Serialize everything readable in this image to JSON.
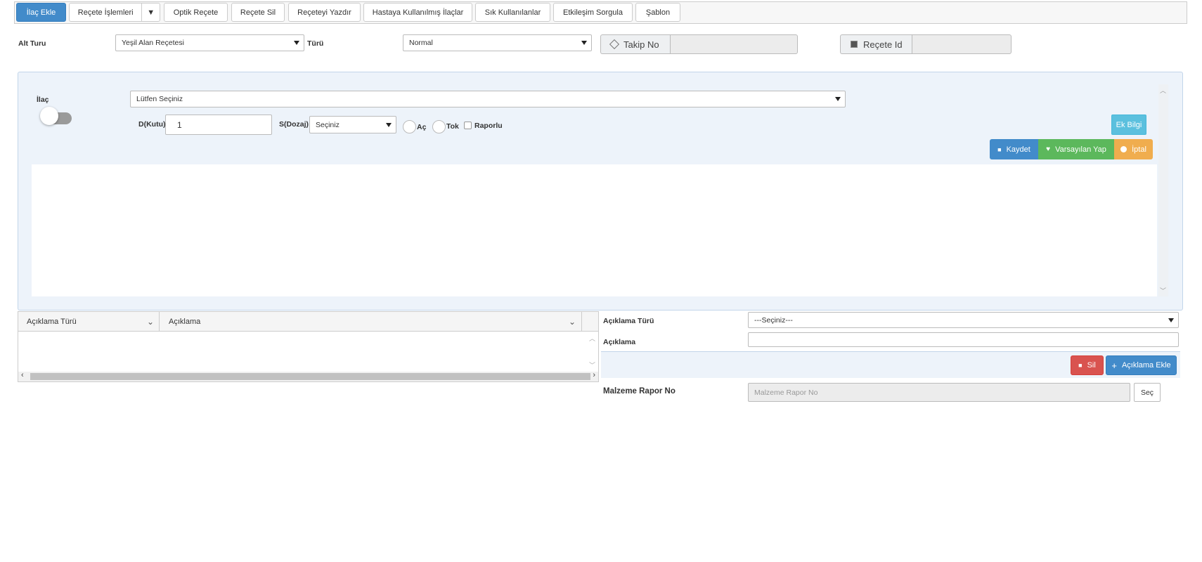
{
  "toolbar": {
    "ilac_ekle": "İlaç Ekle",
    "recete_islemleri": "Reçete İşlemleri",
    "optik_recete": "Optik Reçete",
    "recete_sil": "Reçete Sil",
    "receteyi_yazdir": "Reçeteyi Yazdır",
    "hastaya_kullanilmis": "Hastaya Kullanılmış İlaçlar",
    "sik_kullanilanlar": "Sık Kullanılanlar",
    "etkilesim_sorgula": "Etkileşim Sorgula",
    "sablon": "Şablon"
  },
  "header": {
    "alt_turu_label": "Alt Turu",
    "alt_turu_value": "Yeşil Alan Reçetesi",
    "turu_label": "Türü",
    "turu_value": "Normal",
    "takip_no_label": "Takip No",
    "takip_no_value": "",
    "recete_id_label": "Reçete Id",
    "recete_id_value": ""
  },
  "ilac_panel": {
    "ilac_label": "İlaç",
    "ilac_select": "Lütfen Seçiniz",
    "d_kutu_label": "D(Kutu)",
    "d_kutu_value": "1",
    "s_dozaj_label": "S(Dozaj)",
    "s_dozaj_value": "Seçiniz",
    "ac_label": "Aç",
    "tok_label": "Tok",
    "raporlu_label": "Raporlu",
    "ek_bilgi": "Ek Bilgi",
    "kaydet": "Kaydet",
    "varsayilan_yap": "Varsayılan Yap",
    "iptal": "İptal"
  },
  "aciklama_grid": {
    "columns": [
      "Açıklama Türü",
      "Açıklama"
    ]
  },
  "aciklama_form": {
    "turu_label": "Açıklama Türü",
    "turu_value": "---Seçiniz---",
    "aciklama_label": "Açıklama",
    "aciklama_value": "",
    "sil": "Sil",
    "aciklama_ekle": "Açıklama Ekle",
    "malzeme_label": "Malzeme Rapor No",
    "malzeme_placeholder": "Malzeme Rapor No",
    "sec": "Seç"
  },
  "colors": {
    "primary": "#428bca",
    "success": "#5cb85c",
    "warning": "#f0ad4e",
    "danger": "#d9534f",
    "info": "#5bc0de"
  }
}
